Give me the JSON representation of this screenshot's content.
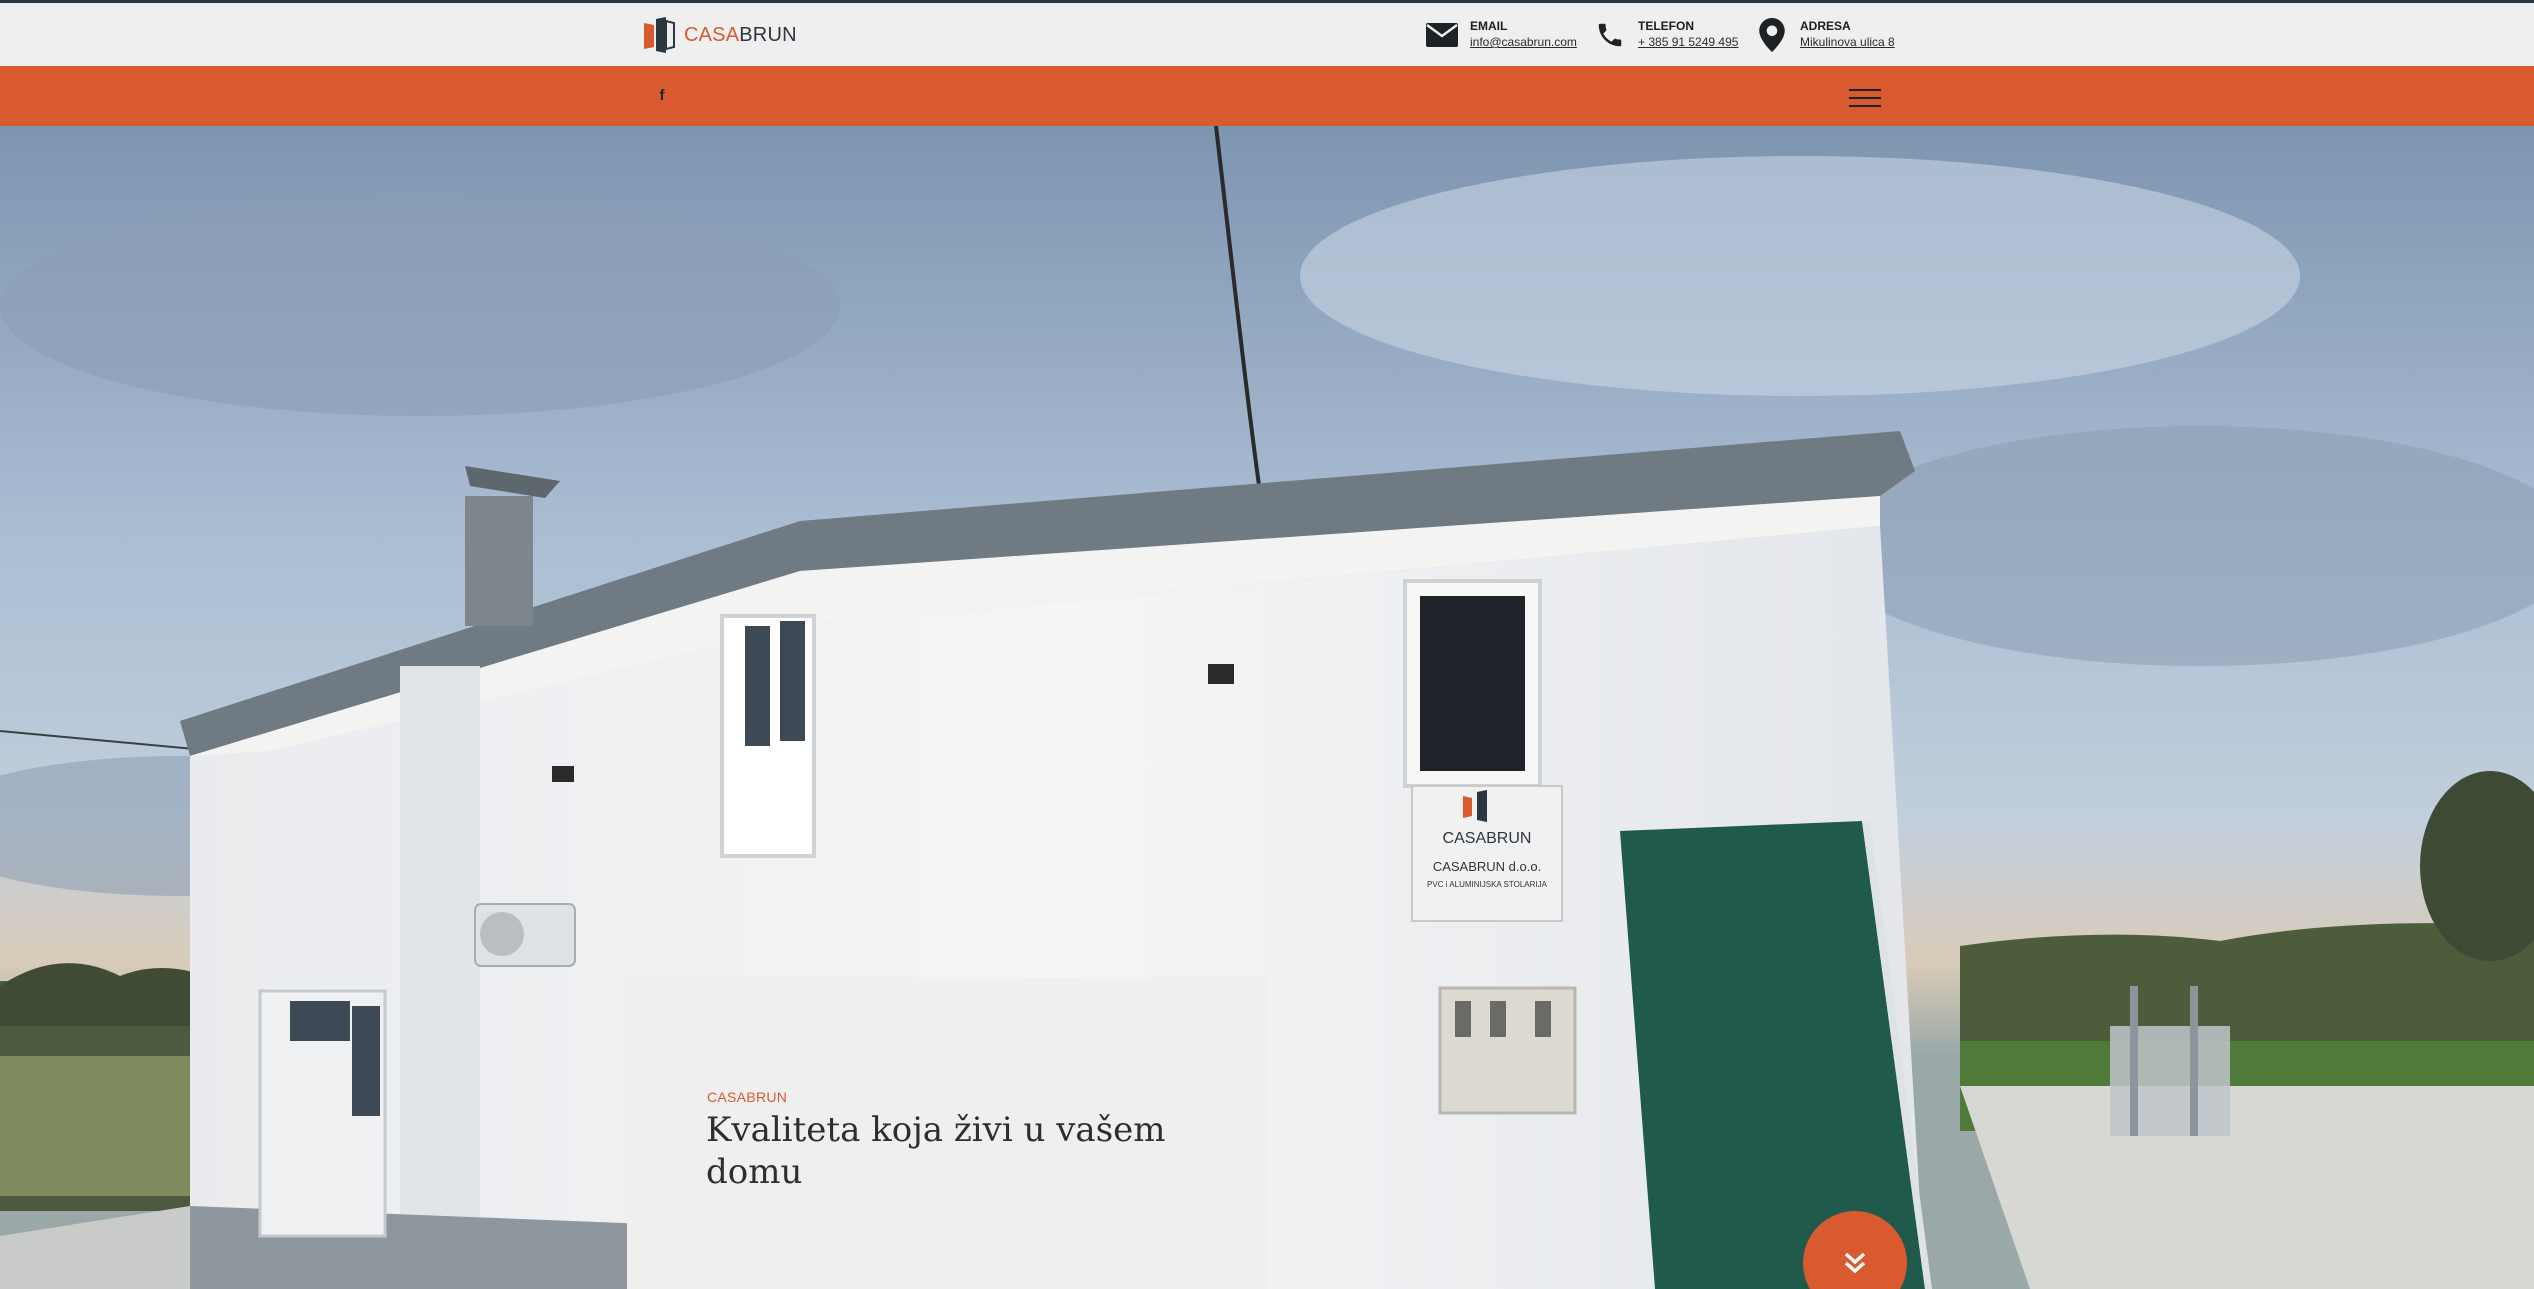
{
  "brand": {
    "name_part1": "CASA",
    "name_part2": "BRUN",
    "accent_color": "#d95a2e",
    "dark_color": "#2b3640"
  },
  "contacts": {
    "email": {
      "icon": "envelope-icon",
      "label": "EMAIL",
      "value": "info@casabrun.com"
    },
    "phone": {
      "icon": "phone-icon",
      "label": "TELEFON",
      "value": "+ 385 91 5249 495"
    },
    "address": {
      "icon": "location-pin-icon",
      "label": "ADRESA",
      "value": "Mikulinova ulica 8"
    }
  },
  "nav": {
    "social_icon": "facebook-icon",
    "social_glyph": "f",
    "menu_icon": "hamburger-menu-icon"
  },
  "hero": {
    "image": "photo of white CASABRUN building with green door under cloudy sky",
    "sign": {
      "brand": "CASABRUN",
      "company": "CASABRUN d.o.o.",
      "tagline": "PVC i ALUMINIJSKA STOLARIJA"
    },
    "eyebrow": "CASABRUN",
    "headline": "Kvaliteta koja živi u vašem domu",
    "scroll_icon": "double-chevron-down-icon"
  }
}
